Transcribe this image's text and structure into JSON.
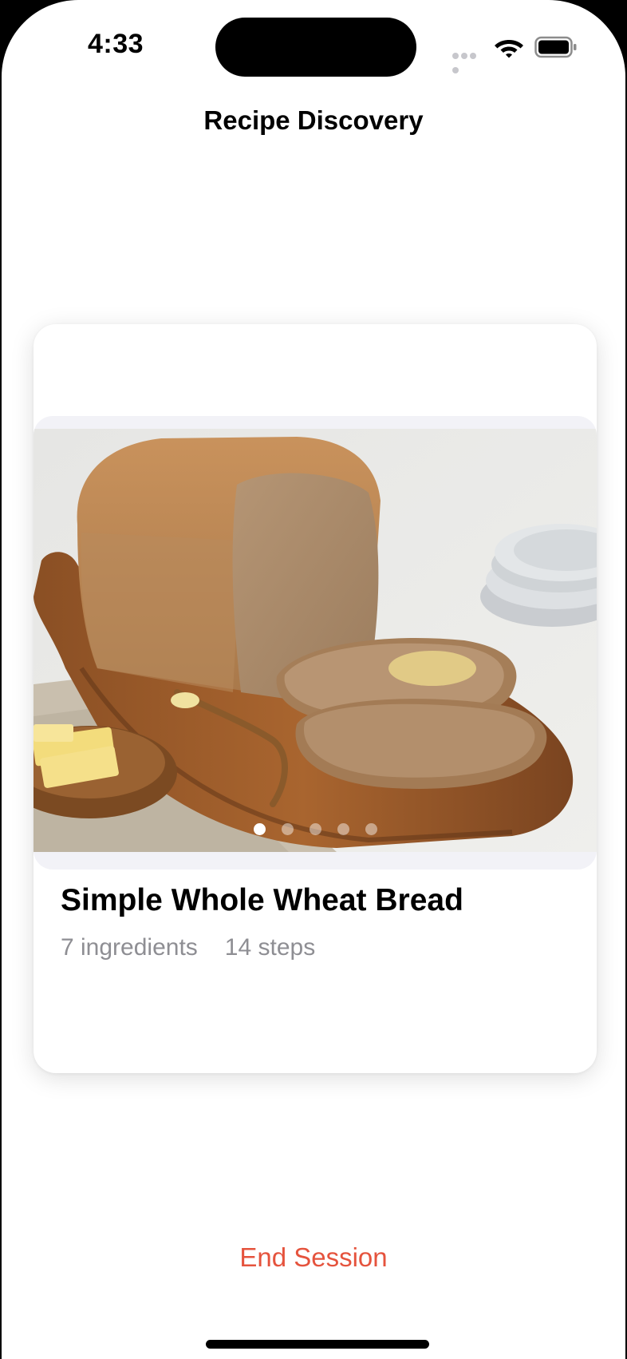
{
  "status_bar": {
    "time": "4:33"
  },
  "nav": {
    "title": "Recipe Discovery"
  },
  "recipe_card": {
    "title": "Simple Whole Wheat Bread",
    "ingredients": "7 ingredients",
    "steps": "14 steps",
    "image_icon": "bread-photo",
    "carousel": {
      "page_count": 5,
      "current_page": 1
    }
  },
  "actions": {
    "end_session": "End Session"
  },
  "colors": {
    "accent": "#e5533d",
    "secondary_text": "#8e8e93"
  }
}
